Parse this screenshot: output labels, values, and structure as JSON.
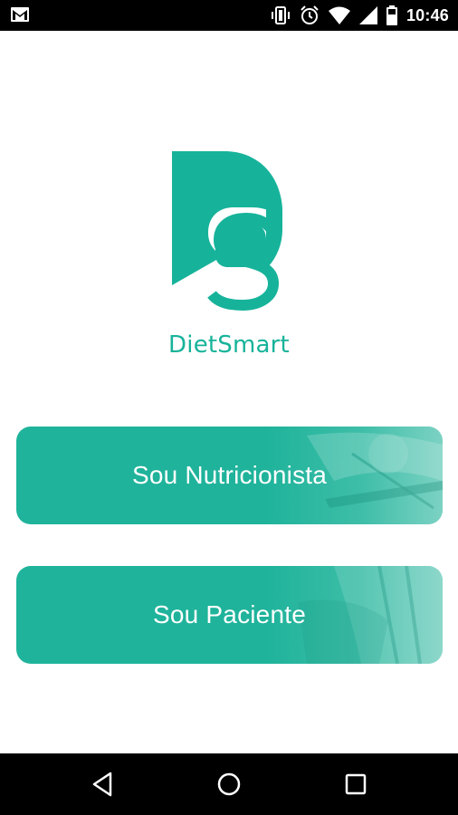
{
  "status_bar": {
    "time": "10:46",
    "icons": [
      "gmail-icon",
      "vibrate-icon",
      "alarm-icon",
      "wifi-icon",
      "signal-icon",
      "battery-icon"
    ]
  },
  "app": {
    "brand_name": "DietSmart",
    "logo_letters": "DS",
    "accent_color": "#16b39a"
  },
  "buttons": {
    "nutritionist_label": "Sou Nutricionista",
    "patient_label": "Sou Paciente"
  },
  "nav_bar": {
    "icons": [
      "back-icon",
      "home-icon",
      "recent-apps-icon"
    ]
  }
}
